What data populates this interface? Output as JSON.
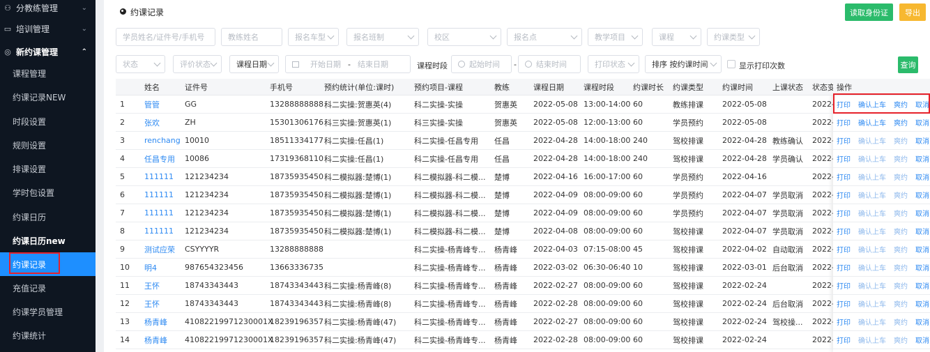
{
  "sidebar": {
    "top_items": [
      {
        "label": "分教练管理",
        "icon": "user-group-icon"
      },
      {
        "label": "培训管理",
        "icon": "book-icon"
      },
      {
        "label": "新约课管理",
        "icon": "calendar-icon"
      }
    ],
    "items": [
      {
        "label": "课程管理"
      },
      {
        "label": "约课记录NEW"
      },
      {
        "label": "时段设置"
      },
      {
        "label": "规则设置"
      },
      {
        "label": "排课设置"
      },
      {
        "label": "学时包设置"
      },
      {
        "label": "约课日历"
      },
      {
        "label": "约课日历new"
      },
      {
        "label": "约课记录"
      },
      {
        "label": "充值记录"
      },
      {
        "label": "约课学员管理"
      },
      {
        "label": "约课统计"
      }
    ]
  },
  "header": {
    "title": "约课记录",
    "read_id_button": "读取身份证",
    "export_button": "导出"
  },
  "filters": {
    "row1": [
      {
        "placeholder": "学员姓名/证件号/手机号"
      },
      {
        "placeholder": "教练姓名"
      },
      {
        "placeholder": "报名车型"
      },
      {
        "placeholder": "报名班制"
      },
      {
        "placeholder": "校区"
      },
      {
        "placeholder": "报名点"
      },
      {
        "placeholder": "教学项目"
      },
      {
        "placeholder": "课程"
      },
      {
        "placeholder": "约课类型"
      }
    ],
    "status": "状态",
    "eval_status": "评价状态",
    "course_date": "课程日期",
    "start_date": "开始日期",
    "date_sep": "-",
    "end_date": "结束日期",
    "time_label": "课程时段",
    "start_time": "起始时间",
    "time_sep": "-",
    "end_time": "结束时间",
    "print_status": "打印状态",
    "sort": "排序 按约课时间",
    "show_print_count": "显示打印次数",
    "search_button": "查询"
  },
  "table": {
    "headers": [
      "姓名",
      "证件号",
      "手机号",
      "预约统计(单位:课时)",
      "预约项目-课程",
      "教练",
      "课程日期",
      "课程时段",
      "约课时长",
      "约课类型",
      "约课时间",
      "上课状态",
      "状态变",
      "操作"
    ],
    "ops": [
      "打印",
      "确认上车",
      "爽约",
      "取消"
    ],
    "rows": [
      {
        "idx": "1",
        "name": "管管",
        "id": "GG",
        "phone": "13288888888",
        "stat": "科二实操:贺惠英(4)",
        "course": "科二实操-实操",
        "coach": "贺惠英",
        "date": "2022-05-08",
        "time": "13:00-14:00",
        "dur": "60",
        "type": "教练排课",
        "book": "2022-05-08",
        "state": "",
        "chg": "2022-0"
      },
      {
        "idx": "2",
        "name": "张欢",
        "id": "ZH",
        "phone": "15301306176",
        "stat": "科三实操:贺惠英(1)",
        "course": "科三实操-实操",
        "coach": "贺惠英",
        "date": "2022-05-08",
        "time": "12:00-13:00",
        "dur": "60",
        "type": "学员预约",
        "book": "2022-05-08",
        "state": "",
        "chg": "2022-0"
      },
      {
        "idx": "3",
        "name": "renchang",
        "id": "10010",
        "phone": "18511334177",
        "stat": "科二实操:任昌(1)",
        "course": "科二实操-任昌专用",
        "coach": "任昌",
        "date": "2022-04-28",
        "time": "14:00-18:00",
        "dur": "240",
        "type": "驾校排课",
        "book": "2022-04-28",
        "state": "教练确认",
        "chg": "2022-0"
      },
      {
        "idx": "4",
        "name": "任昌专用",
        "id": "10086",
        "phone": "17319368110",
        "stat": "科二实操:任昌(1)",
        "course": "科二实操-任昌专用",
        "coach": "任昌",
        "date": "2022-04-28",
        "time": "14:00-18:00",
        "dur": "240",
        "type": "驾校排课",
        "book": "2022-04-28",
        "state": "学员确认",
        "chg": "2022-0"
      },
      {
        "idx": "5",
        "name": "111111",
        "id": "121234234",
        "phone": "18735935450",
        "stat": "科二模拟器:楚博(1)",
        "course": "科二模拟器-科二模...",
        "coach": "楚博",
        "date": "2022-04-16",
        "time": "16:00-17:00",
        "dur": "60",
        "type": "学员预约",
        "book": "2022-04-16",
        "state": "",
        "chg": "2022-0"
      },
      {
        "idx": "6",
        "name": "111111",
        "id": "121234234",
        "phone": "18735935450",
        "stat": "科二模拟器:楚博(1)",
        "course": "科二模拟器-科二模...",
        "coach": "楚博",
        "date": "2022-04-09",
        "time": "08:00-09:00",
        "dur": "60",
        "type": "学员预约",
        "book": "2022-04-07",
        "state": "学员取消",
        "chg": "2022-0"
      },
      {
        "idx": "7",
        "name": "111111",
        "id": "121234234",
        "phone": "18735935450",
        "stat": "科二模拟器:楚博(1)",
        "course": "科二模拟器-科二模...",
        "coach": "楚博",
        "date": "2022-04-09",
        "time": "08:00-09:00",
        "dur": "60",
        "type": "学员预约",
        "book": "2022-04-07",
        "state": "学员取消",
        "chg": "2022-0"
      },
      {
        "idx": "8",
        "name": "111111",
        "id": "121234234",
        "phone": "18735935450",
        "stat": "科二模拟器:楚博(1)",
        "course": "科二模拟器-科二模...",
        "coach": "楚博",
        "date": "2022-04-08",
        "time": "08:00-09:00",
        "dur": "60",
        "type": "驾校排课",
        "book": "2022-04-07",
        "state": "学员取消",
        "chg": "2022-0"
      },
      {
        "idx": "9",
        "name": "测试应荣",
        "id": "CSYYYYR",
        "phone": "13288888888",
        "stat": "",
        "course": "科二实操-杨青峰专...",
        "coach": "杨青峰",
        "date": "2022-04-03",
        "time": "07:15-08:00",
        "dur": "45",
        "type": "驾校排课",
        "book": "2022-04-02",
        "state": "自动取消",
        "chg": "2022-0"
      },
      {
        "idx": "10",
        "name": "明4",
        "id": "987654323456",
        "phone": "13663336735",
        "stat": "",
        "course": "科二实操-杨青峰专...",
        "coach": "杨青峰",
        "date": "2022-03-02",
        "time": "06:30-06:40",
        "dur": "10",
        "type": "驾校排课",
        "book": "2022-03-01",
        "state": "后台取消",
        "chg": "2022-0"
      },
      {
        "idx": "11",
        "name": "王怀",
        "id": "18743343443",
        "phone": "18743343443",
        "stat": "科二实操:杨青峰(8)",
        "course": "科二实操-杨青峰专...",
        "coach": "杨青峰",
        "date": "2022-02-27",
        "time": "08:00-09:00",
        "dur": "60",
        "type": "驾校排课",
        "book": "2022-02-24",
        "state": "",
        "chg": "2022-0"
      },
      {
        "idx": "12",
        "name": "王怀",
        "id": "18743343443",
        "phone": "18743343443",
        "stat": "科二实操:杨青峰(8)",
        "course": "科二实操-杨青峰专...",
        "coach": "杨青峰",
        "date": "2022-02-28",
        "time": "08:00-09:00",
        "dur": "60",
        "type": "驾校排课",
        "book": "2022-02-24",
        "state": "后台取消",
        "chg": "2022-0"
      },
      {
        "idx": "13",
        "name": "杨青峰",
        "id": "41082219971230001X",
        "phone": "18239196357",
        "stat": "科二实操:杨青峰(47)",
        "course": "科二实操-杨青峰专...",
        "coach": "杨青峰",
        "date": "2022-02-27",
        "time": "08:00-09:00",
        "dur": "60",
        "type": "驾校排课",
        "book": "2022-02-24",
        "state": "驾校操...",
        "chg": "2022-0"
      },
      {
        "idx": "14",
        "name": "杨青峰",
        "id": "41082219971230001X",
        "phone": "18239196357",
        "stat": "科二实操:杨青峰(47)",
        "course": "科二实操-杨青峰专...",
        "coach": "杨青峰",
        "date": "2022-02-28",
        "time": "08:00-09:00",
        "dur": "60",
        "type": "驾校排课",
        "book": "2022-02-24",
        "state": "",
        "chg": "2022-0"
      }
    ]
  }
}
